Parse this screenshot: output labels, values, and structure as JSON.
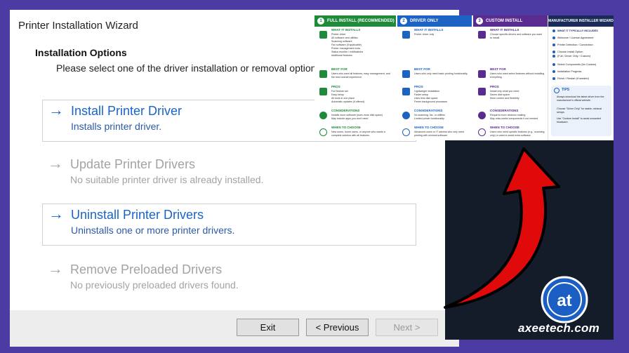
{
  "wizard": {
    "title": "Printer Installation Wizard",
    "heading": "Installation Options",
    "subheading": "Please select one of the driver installation or removal options.",
    "options": [
      {
        "label": "Install Printer Driver",
        "description": "Installs printer driver.",
        "enabled": true
      },
      {
        "label": "Update Printer Drivers",
        "description": "No suitable printer driver is already installed.",
        "enabled": false
      },
      {
        "label": "Uninstall Printer Drivers",
        "description": "Uninstalls one or more printer drivers.",
        "enabled": true
      },
      {
        "label": "Remove Preloaded Drivers",
        "description": "No previously preloaded drivers found.",
        "enabled": false
      }
    ],
    "buttons": {
      "exit": "Exit",
      "previous": "< Previous",
      "next": "Next >"
    },
    "arrow_glyph": "→"
  },
  "infographic": {
    "columns": [
      {
        "number": "1",
        "title": "FULL INSTALL",
        "tag": "(RECOMMENDED)",
        "color": "#1e8a3a",
        "what_title": "WHAT IT INSTALLS",
        "what_text": "Printer driver\nAll software and utilities\nScanning software\nFax software (if applicable)\nPrinter management tools\nStatus monitor / notifications\nAdditional features",
        "best_title": "BEST FOR",
        "best_text": "Users who want all features, easy management, and the best overall experience.",
        "pros_title": "PROS",
        "pros_text": "Full feature set\nEasy setup\nAll tools in one place\nAutomatic updates (if offered)",
        "cons_title": "CONSIDERATIONS",
        "cons_text": "Installs more software (uses more disk space)\nMay include apps you don't need",
        "when_title": "WHEN TO CHOOSE",
        "when_text": "New users, home users, or anyone who wants a complete solution with all features."
      },
      {
        "number": "2",
        "title": "DRIVER ONLY",
        "tag": "",
        "color": "#1c63c4",
        "what_title": "WHAT IT INSTALLS",
        "what_text": "Printer driver only",
        "best_title": "BEST FOR",
        "best_text": "Users who only need basic printing functionality.",
        "pros_title": "PROS",
        "pros_text": "Lightweight installation\nFaster setup\nUses less disk space\nFewer background processes",
        "cons_title": "CONSIDERATIONS",
        "cons_text": "No scanning, fax, or utilities\nLimited printer functionality",
        "when_title": "WHEN TO CHOOSE",
        "when_text": "Advanced users or IT admins who only need printing with minimal software."
      },
      {
        "number": "3",
        "title": "CUSTOM INSTALL",
        "tag": "",
        "color": "#5a2c8f",
        "what_title": "WHAT IT INSTALLS",
        "what_text": "Choose specific drivers and software you want to install",
        "best_title": "BEST FOR",
        "best_text": "Users who want select features without installing everything.",
        "pros_title": "PROS",
        "pros_text": "Install only what you need\nSaves disk space\nMore control and flexibility",
        "cons_title": "CONSIDERATIONS",
        "cons_text": "Requires more decision making\nMay miss useful components if not needed",
        "when_title": "WHEN TO CHOOSE",
        "when_text": "Users who need specific features (e.g., scanning only) or want to avoid extra software."
      }
    ],
    "manufacturer": {
      "title": "MANUFACTURER INSTALLER WIZARD",
      "subtitle": "WHAT IT TYPICALLY INCLUDES",
      "items": [
        "Welcome / License Agreement",
        "Printer Detection / Connection",
        "Choose Install Option",
        "(Full / Driver Only / Custom)",
        "Select Components (for Custom)",
        "Installation Progress",
        "Finish / Restart (if needed)"
      ],
      "tips_title": "TIPS",
      "tips": [
        "Always download the latest driver from the manufacturer's official website.",
        "Choose \"Driver Only\" for stable, minimal setups.",
        "Use \"Custom Install\" to avoid unwanted bloatware."
      ]
    }
  },
  "brand": {
    "logo_letters": "at",
    "name": "axeetech.com"
  },
  "colors": {
    "frame": "#4b3ba3",
    "promo_bg": "#141c2a",
    "arrow": "#e10a0a",
    "link_blue": "#1a64c8"
  }
}
